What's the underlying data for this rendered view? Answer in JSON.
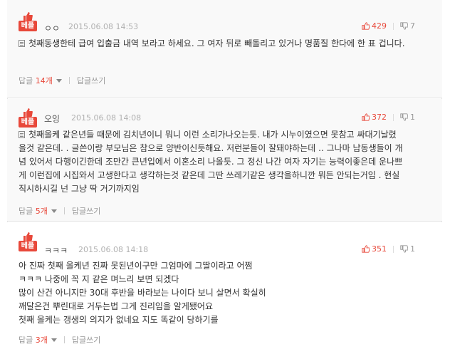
{
  "comments": [
    {
      "badge": "베플",
      "nick": "ㅇㅇ",
      "date": "2015.06.08 14:53",
      "up": "429",
      "down": "7",
      "lines": [
        "첫째동생한테 급여 입출금 내역 보라고 하세요. 그 여자 뒤로 빼돌리고 있거나 명품질 한다에 한 표 겁니다."
      ],
      "reply_label": "답글",
      "reply_count": "14개",
      "write_label": "답글쓰기"
    },
    {
      "badge": "베플",
      "nick": "오잉",
      "date": "2015.06.08 14:08",
      "up": "372",
      "down": "1",
      "lines": [
        "첫째올케 같은년들 때문에 김치년이니 뭐니 이런 소리가나오는듯. 내가 시누이였으면 못참고 싸대기날렸",
        "을것 같은데. . 글쓴이랑 부모님은 참으로 양반이신듯해요. 저런분들이 잘돼야하는데 .. 그나마 남동생들이 개",
        "념 있어서 다행이긴한데 조만간 큰년입에서 이혼소리 나올듯. 그 정신 나간 여자 자기는 능력이좋은데 운나쁘",
        "게 이런집에 시집와서 고생한다고 생각하는것 같은데 그딴 쓰레기같은 생각을하니깐 뭐든 안되는거임 . 현실",
        "직시하시길 넌 그냥 딱 거기까지임"
      ],
      "reply_label": "답글",
      "reply_count": "5개",
      "write_label": "답글쓰기"
    },
    {
      "badge": "베플",
      "nick": "ㅋㅋㅋ",
      "date": "2015.06.08 14:18",
      "up": "351",
      "down": "1",
      "lines": [
        "아 진짜 첫째 올케년 진짜 못된년이구만 그엄마에 그딸이라고 어쩜",
        "ㅋㅋㅋ 나중에 꼭 지 같은 며느리 보면 되겠다",
        "많이 산건 아니지만 30대 후반을 바라보는 나이다 보니 살면서 확실히",
        "깨달은건 뿌린대로 거두는법 그게 진리임을 알게됐어요",
        "첫째 올케는 갱생의 의지가 없네요 지도 똑같이 당하기를"
      ],
      "reply_label": "답글",
      "reply_count": "3개",
      "write_label": "답글쓰기"
    }
  ]
}
